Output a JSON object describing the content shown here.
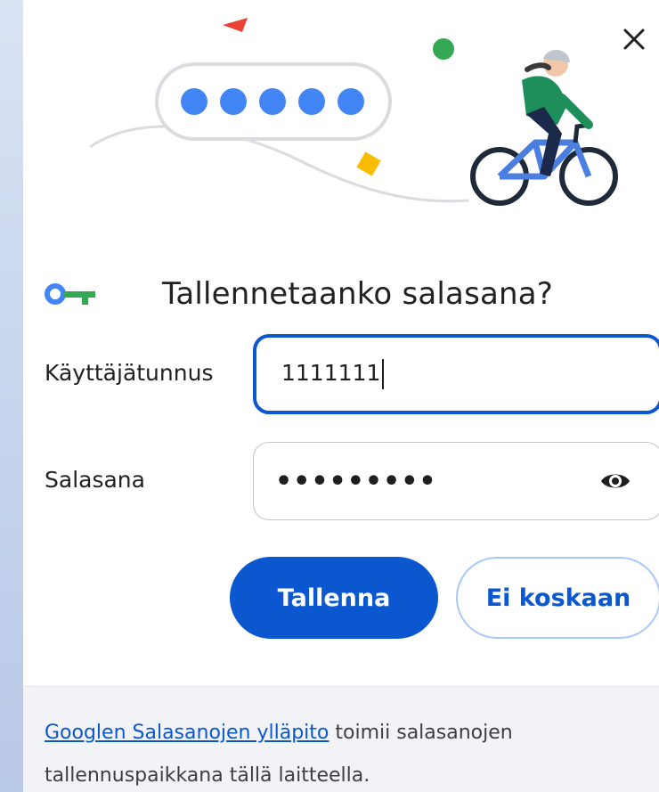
{
  "dialog": {
    "title": "Tallennetaanko salasana?",
    "close_icon": "close-icon",
    "key_icon": "key-icon"
  },
  "fields": {
    "username": {
      "label": "Käyttäjätunnus",
      "value": "1111111"
    },
    "password": {
      "label": "Salasana",
      "masked_value": "•••••••••",
      "reveal_icon": "eye-icon"
    }
  },
  "buttons": {
    "save_label": "Tallenna",
    "never_label": "Ei koskaan"
  },
  "footer": {
    "link_text": "Googlen Salasanojen ylläpito",
    "rest_text": " toimii salasanojen tallennuspaikkana tällä laitteella."
  },
  "colors": {
    "accent": "#0b57d0",
    "footer_bg": "#f1f3f6"
  }
}
